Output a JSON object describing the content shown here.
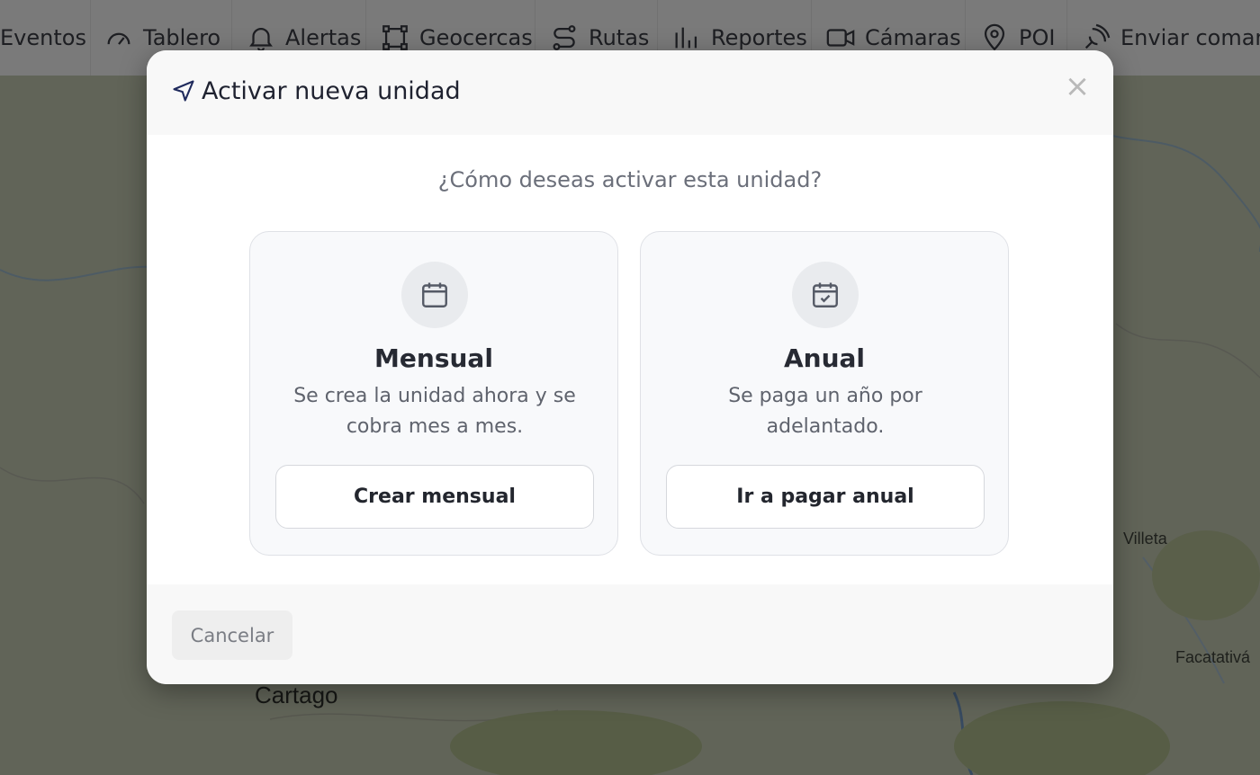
{
  "toolbar": {
    "items": [
      {
        "label": "Eventos",
        "icon": "list-icon"
      },
      {
        "label": "Tablero",
        "icon": "gauge-icon"
      },
      {
        "label": "Alertas",
        "icon": "bell-icon"
      },
      {
        "label": "Geocercas",
        "icon": "geofence-icon"
      },
      {
        "label": "Rutas",
        "icon": "route-icon"
      },
      {
        "label": "Reportes",
        "icon": "bar-chart-icon"
      },
      {
        "label": "Cámaras",
        "icon": "video-camera-icon"
      },
      {
        "label": "POI",
        "icon": "map-pin-icon"
      },
      {
        "label": "Enviar comandos",
        "icon": "satellite-icon"
      }
    ]
  },
  "map": {
    "labels": {
      "cartago": "Cartago",
      "villeta": "Villeta",
      "facatativa": "Facatativá"
    }
  },
  "modal": {
    "title": "Activar nueva unidad",
    "title_icon": "navigation-arrow-icon",
    "close_label": "×",
    "question": "¿Cómo deseas activar esta unidad?",
    "options": {
      "monthly": {
        "icon": "calendar-icon",
        "title": "Mensual",
        "description": "Se crea la unidad ahora y se cobra mes a mes.",
        "button": "Crear mensual"
      },
      "annual": {
        "icon": "calendar-check-icon",
        "title": "Anual",
        "description": "Se paga un año por adelantado.",
        "button": "Ir a pagar anual"
      }
    },
    "cancel_label": "Cancelar"
  },
  "colors": {
    "overlay": "rgba(0,0,0,0.5)",
    "text_dark": "#272a33",
    "text_muted": "#6b6f7a",
    "accent_icon": "#1f2a5c"
  }
}
